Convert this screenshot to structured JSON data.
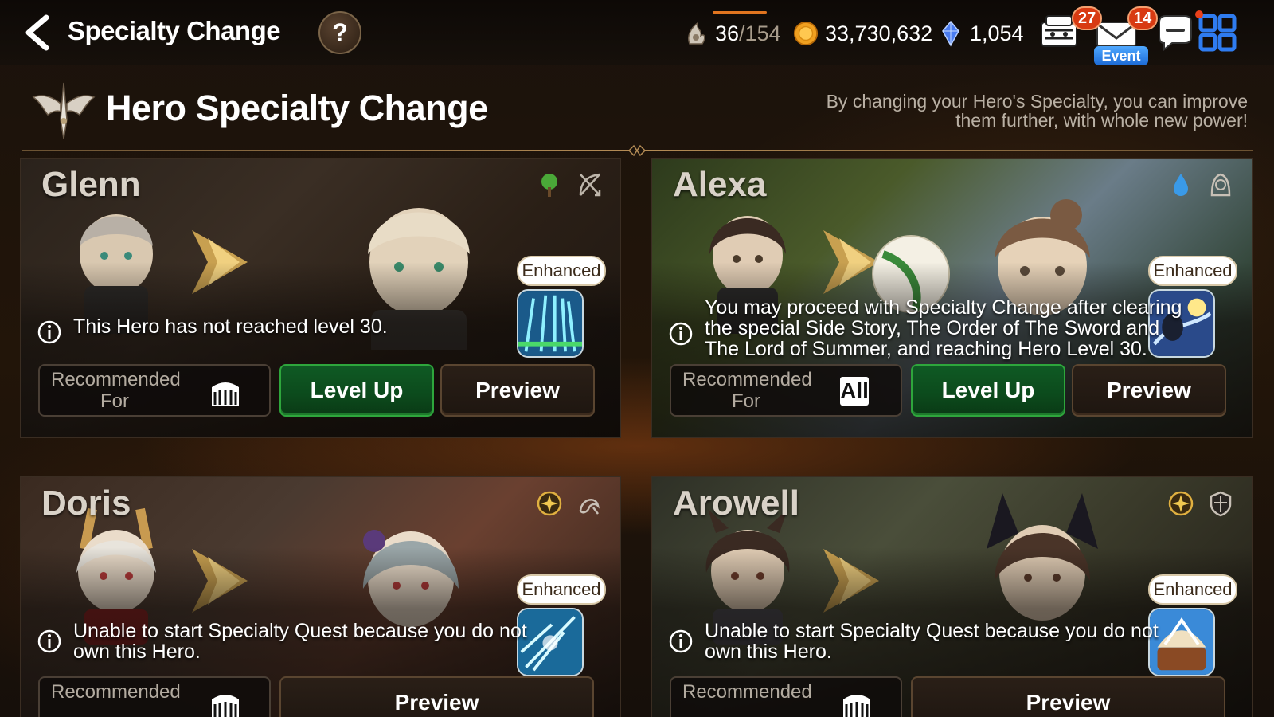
{
  "topbar": {
    "title": "Specialty Change",
    "help": "?",
    "stamina_current": "36",
    "stamina_max": "/154",
    "gold": "33,730,632",
    "crystals": "1,054",
    "mail_badge": "27",
    "event_label": "Event",
    "chat_badge": "14"
  },
  "header": {
    "title": "Hero Specialty Change",
    "description": "By changing your Hero's Specialty, you can improve them further, with whole new power!"
  },
  "cards": [
    {
      "name": "Glenn",
      "element": "earth-icon",
      "class": "ranger-icon",
      "enhanced_label": "Enhanced",
      "message": "This Hero has not reached level 30.",
      "recommended_label": "Recommended\nFor",
      "recommended_icon": "arena-icon",
      "level_up_label": "Level Up",
      "preview_label": "Preview"
    },
    {
      "name": "Alexa",
      "element": "ice-icon",
      "class": "thief-icon",
      "enhanced_label": "Enhanced",
      "message": "You may proceed with Specialty Change after clearing\nthe special Side Story, The Order of The Sword and\nThe Lord of Summer, and reaching Hero Level 30.",
      "recommended_label": "Recommended\nFor",
      "recommended_all": "All",
      "level_up_label": "Level Up",
      "preview_label": "Preview"
    },
    {
      "name": "Doris",
      "element": "light-icon",
      "class": "soul-weaver-icon",
      "enhanced_label": "Enhanced",
      "message": "Unable to start Specialty Quest because you do not\nown this Hero.",
      "recommended_label": "Recommended",
      "recommended_icon": "arena-icon",
      "preview_label": "Preview"
    },
    {
      "name": "Arowell",
      "element": "light-icon",
      "class": "knight-icon",
      "enhanced_label": "Enhanced",
      "message": "Unable to start Specialty Quest because you do not\nown this Hero.",
      "recommended_label": "Recommended",
      "recommended_icon": "arena-icon",
      "preview_label": "Preview"
    }
  ],
  "colors": {
    "accent_green": "#2ea63c",
    "badge_red": "#d83a12",
    "event_blue": "#1c6ad6",
    "gold": "#e0741f"
  }
}
